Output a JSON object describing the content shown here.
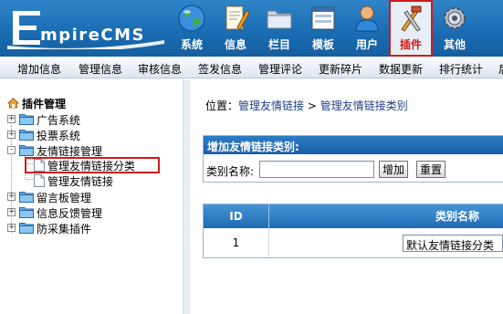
{
  "header": {
    "logo_text": "mpireCMS",
    "nav": [
      {
        "label": "系统",
        "icon": "globe-icon"
      },
      {
        "label": "信息",
        "icon": "document-edit-icon"
      },
      {
        "label": "栏目",
        "icon": "folder-icon"
      },
      {
        "label": "模板",
        "icon": "window-template-icon"
      },
      {
        "label": "用户",
        "icon": "user-icon"
      },
      {
        "label": "插件",
        "icon": "tools-icon",
        "active": true
      },
      {
        "label": "其他",
        "icon": "gear-icon"
      }
    ]
  },
  "submenu": [
    "增加信息",
    "管理信息",
    "审核信息",
    "签发信息",
    "管理评论",
    "更新碎片",
    "数据更新",
    "排行统计",
    "后"
  ],
  "tree": {
    "title": "插件管理",
    "items": [
      {
        "label": "广告系统",
        "toggle": "+"
      },
      {
        "label": "投票系统",
        "toggle": "+"
      },
      {
        "label": "友情链接管理",
        "toggle": "-",
        "children": [
          "管理友情链接分类",
          "管理友情链接"
        ]
      },
      {
        "label": "留言板管理",
        "toggle": "+"
      },
      {
        "label": "信息反馈管理",
        "toggle": "+"
      },
      {
        "label": "防采集插件",
        "toggle": "+"
      }
    ]
  },
  "main": {
    "breadcrumb": {
      "prefix": "位置：",
      "link1": "管理友情链接",
      "sep": " > ",
      "link2": "管理友情链接类别"
    },
    "form": {
      "title": "增加友情链接类别:",
      "label": "类别名称:",
      "value": "",
      "add_button": "增加",
      "reset_button": "重置"
    },
    "table": {
      "headers": [
        "ID",
        "类别名称"
      ],
      "rows": [
        {
          "id": "1",
          "name": "默认友情链接分类"
        }
      ]
    }
  },
  "colors": {
    "header_blue": "#1a6bb2",
    "active_border": "#d11a1a",
    "link": "#1a3f87"
  }
}
